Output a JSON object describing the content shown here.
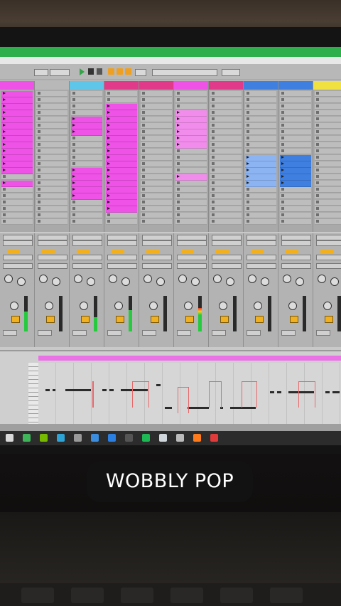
{
  "caption": "WOBBLY POP",
  "colors": {
    "clip_magenta": "#ee52e6",
    "clip_light_magenta": "#f28cec",
    "clip_blue": "#3f7fe0",
    "clip_light_blue": "#8db4f2",
    "header_cyan": "#5ec6e8",
    "header_pink": "#e23a8a",
    "header_yellow": "#f0e040",
    "fader_orange": "#f0b020",
    "meter_green": "#27c93f",
    "screen_green_bar": "#2fae4c",
    "caption_bg": "#121212"
  },
  "session": {
    "tracks": [
      {
        "head_color": "#ee52e6",
        "clip_color": "#ee52e6",
        "clips": [
          0,
          1,
          2,
          3,
          4,
          5,
          6,
          7,
          8,
          9,
          10,
          11,
          12,
          14
        ]
      },
      {
        "head_color": "#b8b8b8",
        "clip_color": "",
        "clips": []
      },
      {
        "head_color": "#5ec6e8",
        "clip_color": "#ee52e6",
        "clips": [
          4,
          5,
          6,
          12,
          13,
          14,
          15,
          16
        ]
      },
      {
        "head_color": "#e23a8a",
        "clip_color": "#ee52e6",
        "clips": [
          2,
          3,
          4,
          5,
          6,
          7,
          8,
          9,
          10,
          11,
          12,
          13,
          14,
          15,
          16,
          17,
          18
        ]
      },
      {
        "head_color": "#e23a8a",
        "clip_color": "",
        "clips": []
      },
      {
        "head_color": "#ee52e6",
        "clip_color": "#f28cec",
        "clips": [
          3,
          4,
          5,
          6,
          7,
          8,
          13
        ]
      },
      {
        "head_color": "#e23a8a",
        "clip_color": "",
        "clips": []
      },
      {
        "head_color": "#3f7fe0",
        "clip_color": "#8db4f2",
        "clips": [
          10,
          11,
          12,
          13,
          14
        ]
      },
      {
        "head_color": "#3f7fe0",
        "clip_color": "#3f7fe0",
        "clips": [
          10,
          11,
          12,
          13,
          14
        ]
      },
      {
        "head_color": "#f0e040",
        "clip_color": "",
        "clips": []
      }
    ]
  },
  "mixer": {
    "strips": [
      {
        "meter_level": 0.55,
        "hot": false
      },
      {
        "meter_level": 0.0,
        "hot": false
      },
      {
        "meter_level": 0.4,
        "hot": false
      },
      {
        "meter_level": 0.6,
        "hot": false
      },
      {
        "meter_level": 0.0,
        "hot": false
      },
      {
        "meter_level": 0.65,
        "hot": true
      },
      {
        "meter_level": 0.0,
        "hot": false
      },
      {
        "meter_level": 0.0,
        "hot": false
      },
      {
        "meter_level": 0.0,
        "hot": false
      },
      {
        "meter_level": 0.0,
        "hot": false
      }
    ]
  },
  "taskbar": {
    "icons": [
      "windows-icon",
      "chrome-icon",
      "nvidia-icon",
      "store-icon",
      "settings-icon",
      "edge-icon",
      "defender-icon",
      "terminal-icon",
      "spotify-icon",
      "steam-icon",
      "ableton-icon",
      "firefox-icon",
      "app-red-icon"
    ],
    "icon_colors": [
      "#d9d9d9",
      "#3fb55a",
      "#76b900",
      "#2ea3d6",
      "#9a9a9a",
      "#3b8de0",
      "#2a7fe0",
      "#555555",
      "#1db954",
      "#cfd6dc",
      "#bbbbbb",
      "#ff7a1a",
      "#e03a3a"
    ]
  }
}
